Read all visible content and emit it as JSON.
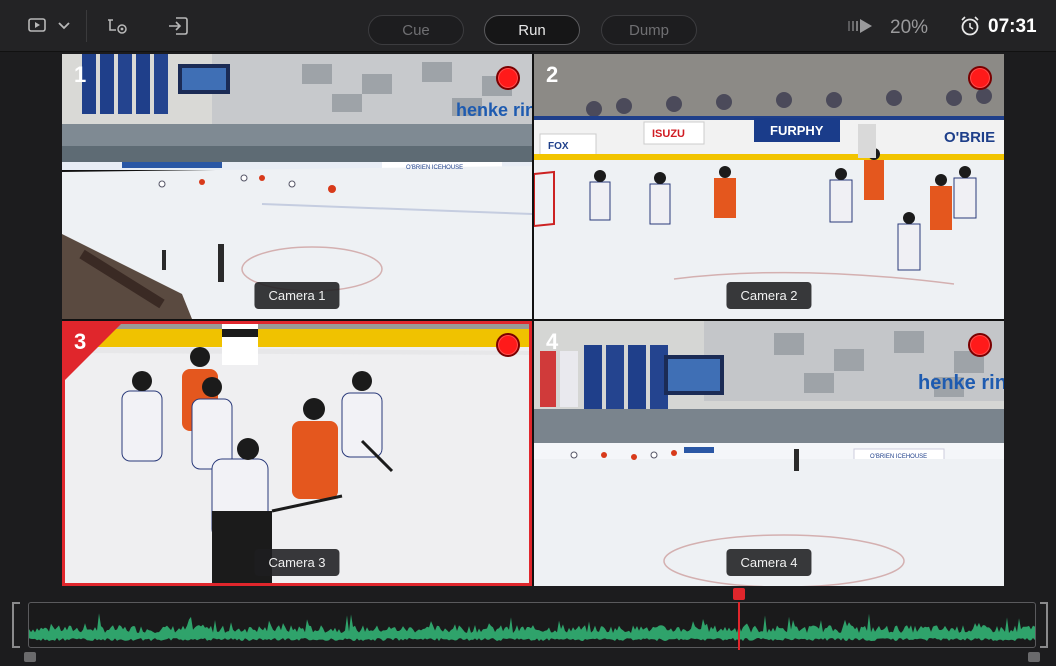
{
  "toolbar": {
    "icons": [
      "source-view-icon",
      "chevron-down-icon",
      "audio-monitor-icon",
      "input-select-icon"
    ],
    "buttons": {
      "cue": "Cue",
      "run": "Run",
      "dump": "Dump"
    },
    "zoom": "20%",
    "timecode": "07:31"
  },
  "cameras": [
    {
      "number": "1",
      "label": "Camera 1",
      "recording": true,
      "selected": false
    },
    {
      "number": "2",
      "label": "Camera 2",
      "recording": true,
      "selected": false
    },
    {
      "number": "3",
      "label": "Camera 3",
      "recording": true,
      "selected": true
    },
    {
      "number": "4",
      "label": "Camera 4",
      "recording": true,
      "selected": false
    }
  ],
  "scene_text": {
    "banner_right": "henke rin",
    "board_obrien": "O'BRIEN ICEHOUSE",
    "board_furphy": "FURPHY",
    "board_isuzu": "ISUZU",
    "board_fox": "FOX",
    "board_obrien_short": "O'BRIE"
  },
  "timeline": {
    "playhead_fraction": 0.705
  },
  "colors": {
    "record": "#ff1a1a",
    "selection": "#e0262c",
    "waveform": "#2fa36b",
    "accent": "#e0262c"
  }
}
